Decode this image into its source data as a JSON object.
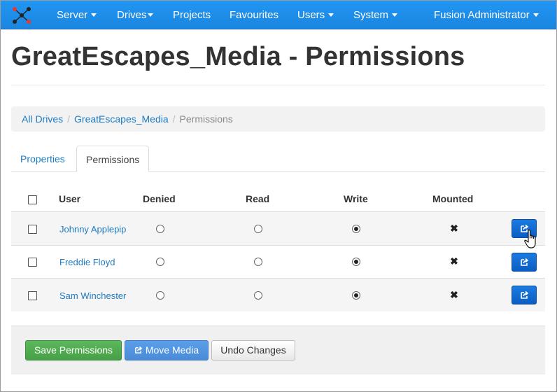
{
  "navbar": {
    "logo_icon": "network-logo-icon",
    "items": [
      {
        "label": "Server",
        "dropdown": true
      },
      {
        "label": "Drives",
        "dropdown": true
      },
      {
        "label": "Projects",
        "dropdown": false
      },
      {
        "label": "Favourites",
        "dropdown": false
      },
      {
        "label": "Users",
        "dropdown": true
      },
      {
        "label": "System",
        "dropdown": true
      }
    ],
    "user_menu": {
      "label": "Fusion Administrator",
      "dropdown": true
    },
    "color": "#1e88e5"
  },
  "page": {
    "title": "GreatEscapes_Media - Permissions"
  },
  "breadcrumb": [
    {
      "label": "All Drives",
      "link": true
    },
    {
      "label": "GreatEscapes_Media",
      "link": true
    },
    {
      "label": "Permissions",
      "link": false
    }
  ],
  "tabs": [
    {
      "label": "Properties",
      "active": false
    },
    {
      "label": "Permissions",
      "active": true
    }
  ],
  "table": {
    "headers": {
      "user": "User",
      "denied": "Denied",
      "read": "Read",
      "write": "Write",
      "mounted": "Mounted"
    },
    "rows": [
      {
        "user": "Johnny Applepip",
        "permission": "write",
        "mounted": false,
        "selected": false
      },
      {
        "user": "Freddie Floyd",
        "permission": "write",
        "mounted": false,
        "selected": false
      },
      {
        "user": "Sam Winchester",
        "permission": "write",
        "mounted": false,
        "selected": false
      }
    ],
    "row_action_icon": "share-icon"
  },
  "actions": {
    "save_label": "Save Permissions",
    "move_label": "Move Media",
    "undo_label": "Undo Changes"
  },
  "colors": {
    "link": "#1f7bc1",
    "save": "#5cb85c",
    "move": "#4a8bd8",
    "row_button": "#0b5cc4"
  }
}
